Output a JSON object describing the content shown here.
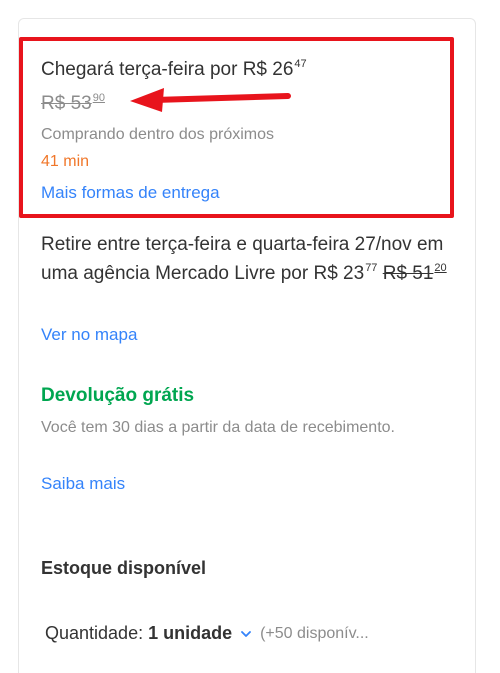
{
  "delivery": {
    "arrival_prefix": "Chegará terça-feira por R$ 26",
    "arrival_cents": "47",
    "old_price_main": "R$ 53",
    "old_price_cents": "90",
    "buying_within": "Comprando dentro dos próximos",
    "timer": "41 min",
    "more_options_link": "Mais formas de entrega"
  },
  "pickup": {
    "text_prefix": "Retire entre terça-feira e quarta-feira 27/nov em uma agência Mercado Livre por R$ 23",
    "price_cents": "77",
    "old_price_main": "R$ 51",
    "old_price_cents": "20",
    "map_link": "Ver no mapa"
  },
  "returns": {
    "title": "Devolução grátis",
    "description": "Você tem 30 dias a partir da data de recebimento.",
    "learn_more_link": "Saiba mais"
  },
  "stock": {
    "title": "Estoque disponível",
    "quantity_label": "Quantidade:",
    "quantity_value": "1 unidade",
    "available_text": "(+50 disponív..."
  },
  "colors": {
    "highlight": "#e8141c",
    "link": "#3483fa",
    "timer": "#f0772a",
    "free_return": "#00a650"
  },
  "icons": {
    "annotation": "red-arrow-icon",
    "dropdown": "chevron-down-icon"
  }
}
